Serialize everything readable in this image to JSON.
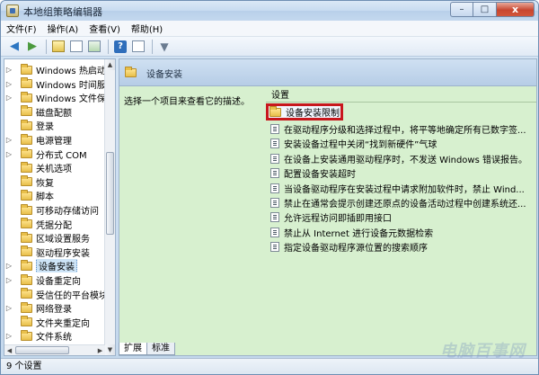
{
  "window": {
    "title": "本地组策略编辑器",
    "buttons": {
      "minimize": "–",
      "maximize": "□",
      "close": "x"
    }
  },
  "menu": [
    "文件(F)",
    "操作(A)",
    "查看(V)",
    "帮助(H)"
  ],
  "toolbar": {
    "icons": [
      "back-arrow-icon",
      "forward-arrow-icon",
      "up-folder-icon",
      "show-tree-icon",
      "export-icon",
      "help-icon",
      "properties-icon",
      "filter-icon"
    ]
  },
  "tree": {
    "items": [
      {
        "label": "Windows 热启动",
        "expandable": true
      },
      {
        "label": "Windows 时间服务",
        "expandable": true
      },
      {
        "label": "Windows 文件保护",
        "expandable": true
      },
      {
        "label": "磁盘配额",
        "expandable": false
      },
      {
        "label": "登录",
        "expandable": false
      },
      {
        "label": "电源管理",
        "expandable": true
      },
      {
        "label": "分布式 COM",
        "expandable": true
      },
      {
        "label": "关机选项",
        "expandable": false
      },
      {
        "label": "恢复",
        "expandable": false
      },
      {
        "label": "脚本",
        "expandable": false
      },
      {
        "label": "可移动存储访问",
        "expandable": false
      },
      {
        "label": "凭据分配",
        "expandable": false
      },
      {
        "label": "区域设置服务",
        "expandable": false
      },
      {
        "label": "驱动程序安装",
        "expandable": false
      },
      {
        "label": "设备安装",
        "expandable": true,
        "selected": true
      },
      {
        "label": "设备重定向",
        "expandable": true
      },
      {
        "label": "受信任的平台模块",
        "expandable": false
      },
      {
        "label": "网络登录",
        "expandable": true
      },
      {
        "label": "文件夹重定向",
        "expandable": false
      },
      {
        "label": "文件系统",
        "expandable": true
      }
    ]
  },
  "right": {
    "header_title": "设备安装",
    "description": "选择一个项目来查看它的描述。",
    "column_header": "设置",
    "items": [
      {
        "label": "设备安装限制",
        "type": "folder",
        "highlighted": true
      },
      {
        "label": "在驱动程序分级和选择过程中，将平等地确定所有已数字签...",
        "type": "setting"
      },
      {
        "label": "安装设备过程中关闭“找到新硬件”气球",
        "type": "setting"
      },
      {
        "label": "在设备上安装通用驱动程序时，不发送 Windows 错误报告。",
        "type": "setting"
      },
      {
        "label": "配置设备安装超时",
        "type": "setting"
      },
      {
        "label": "当设备驱动程序在安装过程中请求附加软件时，禁止 Wind...",
        "type": "setting"
      },
      {
        "label": "禁止在通常会提示创建还原点的设备活动过程中创建系统还...",
        "type": "setting"
      },
      {
        "label": "允许远程访问即插即用接口",
        "type": "setting"
      },
      {
        "label": "禁止从 Internet 进行设备元数据检索",
        "type": "setting"
      },
      {
        "label": "指定设备驱动程序源位置的搜索顺序",
        "type": "setting"
      }
    ]
  },
  "tabs": [
    {
      "label": "扩展",
      "active": true
    },
    {
      "label": "标准",
      "active": false
    }
  ],
  "status": "9 个设置",
  "watermark": "电脑百事网"
}
